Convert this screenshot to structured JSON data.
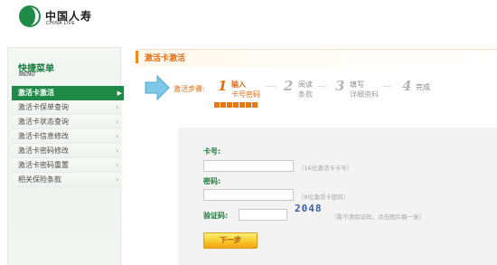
{
  "header": {
    "logo_cn": "中国人寿",
    "logo_en": "CHINA LIFE",
    "brand_color": "#1f8a47"
  },
  "sidebar": {
    "title": "快捷菜单",
    "subtitle": "MENU",
    "items": [
      {
        "label": "激活卡激活",
        "active": true
      },
      {
        "label": "激活卡保单查询",
        "active": false
      },
      {
        "label": "激活卡状态查询",
        "active": false
      },
      {
        "label": "激活卡信息修改",
        "active": false
      },
      {
        "label": "激活卡密码修改",
        "active": false
      },
      {
        "label": "激活卡密码重置",
        "active": false
      },
      {
        "label": "相关保险条款",
        "active": false
      }
    ]
  },
  "main": {
    "title": "激活卡激活",
    "steps_label": "激活步骤:",
    "steps": [
      {
        "num": "1",
        "line1": "输入",
        "line2": "卡号密码",
        "current": true
      },
      {
        "num": "2",
        "line1": "阅读",
        "line2": "条款",
        "current": false
      },
      {
        "num": "3",
        "line1": "填写",
        "line2": "详细资料",
        "current": false
      },
      {
        "num": "4",
        "line1": "完成",
        "line2": "",
        "current": false
      }
    ],
    "accent_color": "#e06a10"
  },
  "form": {
    "card_label": "卡号:",
    "card_value": "",
    "card_hint": "（16位激活卡卡号）",
    "password_label": "密码:",
    "password_value": "",
    "password_hint": "（8位激活卡密码）",
    "captcha_label": "验证码:",
    "captcha_value": "",
    "captcha_image_text": "2048",
    "captcha_hint": "（看不清验证码，点击图片换一张）",
    "submit_label": "下一步"
  }
}
